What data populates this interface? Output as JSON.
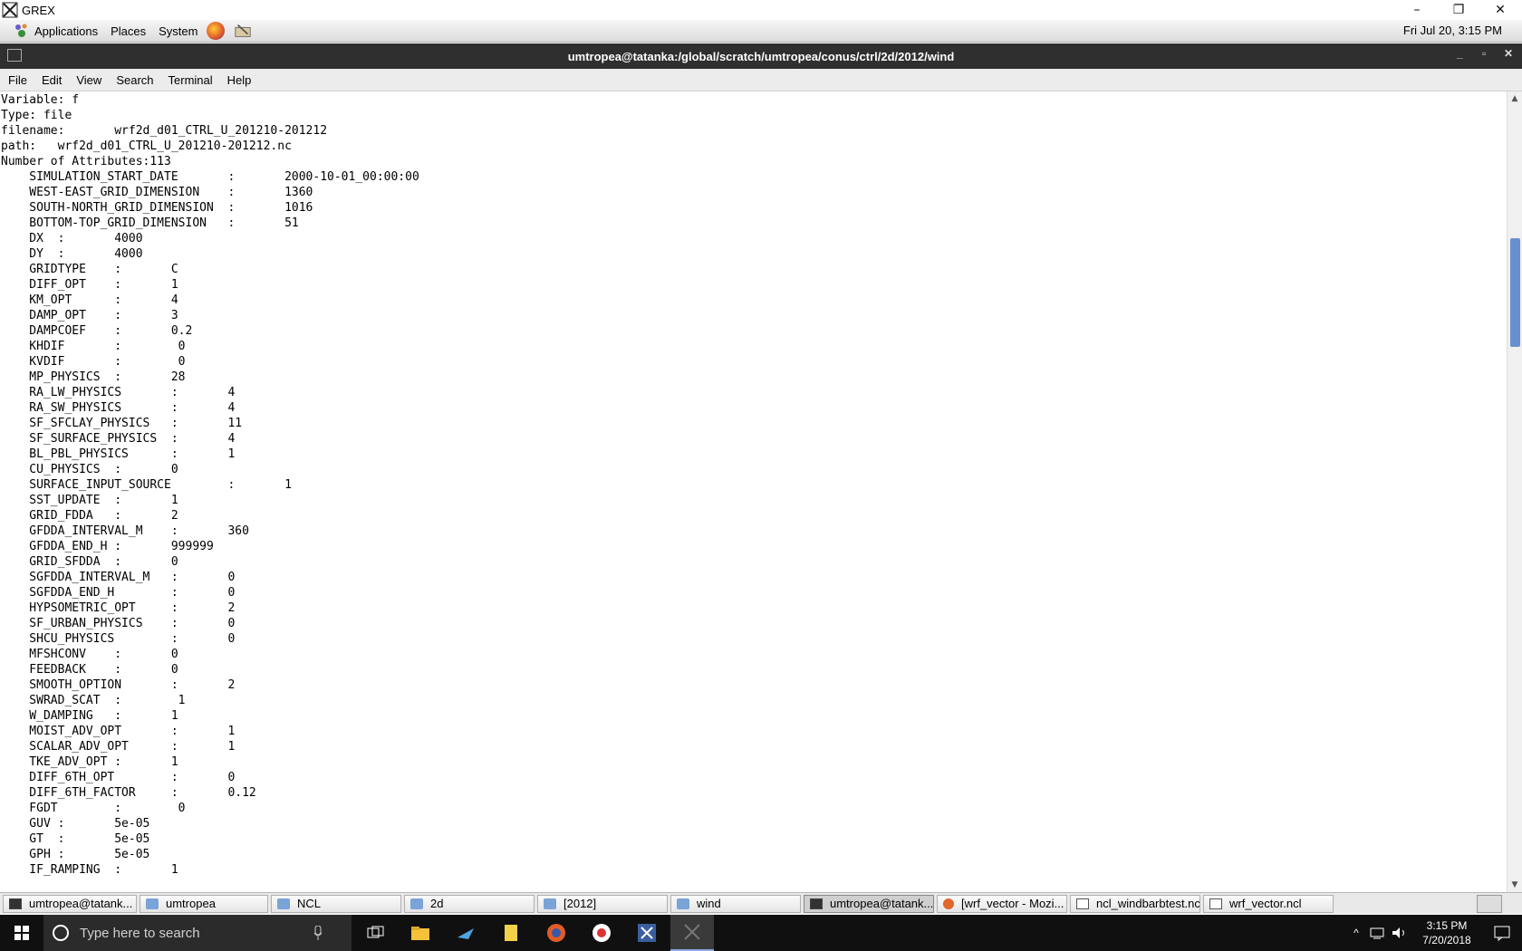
{
  "window": {
    "app_title": "GREX",
    "controls": [
      "–",
      "❐",
      "✕"
    ]
  },
  "top_panel": {
    "menus": [
      "Applications",
      "Places",
      "System"
    ],
    "launchers": [
      "firefox-icon",
      "text-editor-icon"
    ],
    "clock": "Fri Jul 20,  3:15 PM"
  },
  "terminal": {
    "title": "umtropea@tatanka:/global/scratch/umtropea/conus/ctrl/2d/2012/wind",
    "menu": [
      "File",
      "Edit",
      "View",
      "Search",
      "Terminal",
      "Help"
    ],
    "lines": [
      "Variable: f",
      "Type: file",
      "filename:       wrf2d_d01_CTRL_U_201210-201212",
      "path:   wrf2d_d01_CTRL_U_201210-201212.nc",
      "Number of Attributes:113",
      "    SIMULATION_START_DATE       :       2000-10-01_00:00:00",
      "    WEST-EAST_GRID_DIMENSION    :       1360",
      "    SOUTH-NORTH_GRID_DIMENSION  :       1016",
      "    BOTTOM-TOP_GRID_DIMENSION   :       51",
      "    DX  :       4000",
      "    DY  :       4000",
      "    GRIDTYPE    :       C",
      "    DIFF_OPT    :       1",
      "    KM_OPT      :       4",
      "    DAMP_OPT    :       3",
      "    DAMPCOEF    :       0.2",
      "    KHDIF       :        0",
      "    KVDIF       :        0",
      "    MP_PHYSICS  :       28",
      "    RA_LW_PHYSICS       :       4",
      "    RA_SW_PHYSICS       :       4",
      "    SF_SFCLAY_PHYSICS   :       11",
      "    SF_SURFACE_PHYSICS  :       4",
      "    BL_PBL_PHYSICS      :       1",
      "    CU_PHYSICS  :       0",
      "    SURFACE_INPUT_SOURCE        :       1",
      "    SST_UPDATE  :       1",
      "    GRID_FDDA   :       2",
      "    GFDDA_INTERVAL_M    :       360",
      "    GFDDA_END_H :       999999",
      "    GRID_SFDDA  :       0",
      "    SGFDDA_INTERVAL_M   :       0",
      "    SGFDDA_END_H        :       0",
      "    HYPSOMETRIC_OPT     :       2",
      "    SF_URBAN_PHYSICS    :       0",
      "    SHCU_PHYSICS        :       0",
      "    MFSHCONV    :       0",
      "    FEEDBACK    :       0",
      "    SMOOTH_OPTION       :       2",
      "    SWRAD_SCAT  :        1",
      "    W_DAMPING   :       1",
      "    MOIST_ADV_OPT       :       1",
      "    SCALAR_ADV_OPT      :       1",
      "    TKE_ADV_OPT :       1",
      "    DIFF_6TH_OPT        :       0",
      "    DIFF_6TH_FACTOR     :       0.12",
      "    FGDT        :        0",
      "    GUV :       5e-05",
      "    GT  :       5e-05",
      "    GPH :       5e-05",
      "    IF_RAMPING  :       1"
    ]
  },
  "window_list": [
    {
      "label": "umtropea@tatank...",
      "icon": "terminal-icon",
      "active": false
    },
    {
      "label": "umtropea",
      "icon": "folder-icon",
      "active": false
    },
    {
      "label": "NCL",
      "icon": "folder-icon",
      "active": false
    },
    {
      "label": "2d",
      "icon": "folder-icon",
      "active": false
    },
    {
      "label": "[2012]",
      "icon": "folder-icon",
      "active": false
    },
    {
      "label": "wind",
      "icon": "folder-icon",
      "active": false
    },
    {
      "label": "umtropea@tatank...",
      "icon": "terminal-icon",
      "active": true
    },
    {
      "label": "[wrf_vector - Mozi...",
      "icon": "firefox-icon",
      "active": false
    },
    {
      "label": "ncl_windbarbtest.ncl",
      "icon": "text-editor-icon",
      "active": false
    },
    {
      "label": "wrf_vector.ncl",
      "icon": "text-editor-icon",
      "active": false
    }
  ],
  "taskbar": {
    "search_placeholder": "Type here to search",
    "time": "3:15 PM",
    "date": "7/20/2018",
    "pinned": [
      "task-view-icon",
      "file-explorer-icon",
      "xming-icon",
      "documents-icon",
      "firefox-icon",
      "chrome-icon",
      "xwin-icon",
      "grex-icon"
    ]
  },
  "colors": {
    "terminal_title_bg": "#2f2f2f",
    "scroll_thumb": "#6a8fd0",
    "taskbar_bg": "#101010"
  }
}
